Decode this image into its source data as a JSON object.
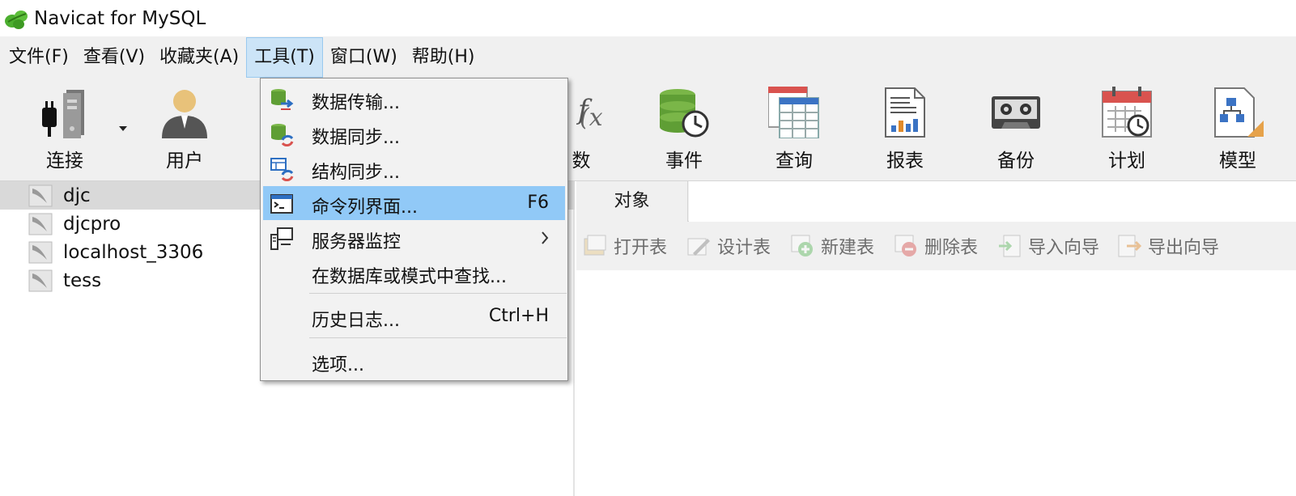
{
  "window": {
    "title": "Navicat for MySQL"
  },
  "menubar": {
    "items": [
      {
        "label": "文件(F)"
      },
      {
        "label": "查看(V)"
      },
      {
        "label": "收藏夹(A)"
      },
      {
        "label": "工具(T)"
      },
      {
        "label": "窗口(W)"
      },
      {
        "label": "帮助(H)"
      }
    ],
    "active_index": 3
  },
  "toolbar": {
    "buttons": [
      {
        "label": "连接",
        "icon": "connection-plug-icon"
      },
      {
        "label": "用户",
        "icon": "user-icon"
      },
      {
        "label": "数",
        "icon": "function-icon"
      },
      {
        "label": "事件",
        "icon": "event-database-clock-icon"
      },
      {
        "label": "查询",
        "icon": "query-table-icon"
      },
      {
        "label": "报表",
        "icon": "report-icon"
      },
      {
        "label": "备份",
        "icon": "backup-tape-icon"
      },
      {
        "label": "计划",
        "icon": "schedule-calendar-icon"
      },
      {
        "label": "模型",
        "icon": "model-diagram-icon"
      }
    ]
  },
  "connections": [
    {
      "label": "djc",
      "selected": true
    },
    {
      "label": "djcpro",
      "selected": false
    },
    {
      "label": "localhost_3306",
      "selected": false
    },
    {
      "label": "tess",
      "selected": false
    }
  ],
  "object_tab": {
    "label": "对象"
  },
  "object_toolbar": {
    "buttons": [
      {
        "label": "打开表",
        "icon": "open-table-icon"
      },
      {
        "label": "设计表",
        "icon": "design-table-icon"
      },
      {
        "label": "新建表",
        "icon": "new-table-icon"
      },
      {
        "label": "删除表",
        "icon": "delete-table-icon"
      },
      {
        "label": "导入向导",
        "icon": "import-wizard-icon"
      },
      {
        "label": "导出向导",
        "icon": "export-wizard-icon"
      }
    ]
  },
  "tools_menu": {
    "items": [
      {
        "label": "数据传输...",
        "shortcut": "",
        "icon": "data-transfer-icon"
      },
      {
        "label": "数据同步...",
        "shortcut": "",
        "icon": "data-sync-icon"
      },
      {
        "label": "结构同步...",
        "shortcut": "",
        "icon": "structure-sync-icon"
      },
      {
        "label": "命令列界面...",
        "shortcut": "F6",
        "icon": "console-icon",
        "highlighted": true
      },
      {
        "label": "服务器监控",
        "shortcut": "",
        "icon": "server-monitor-icon",
        "submenu": true
      },
      {
        "label": "在数据库或模式中查找...",
        "shortcut": ""
      },
      {
        "label": "历史日志...",
        "shortcut": "Ctrl+H"
      },
      {
        "label": "选项...",
        "shortcut": ""
      }
    ]
  },
  "colors": {
    "menu_highlight": "#91c9f7",
    "menubar_active": "#cce4f7",
    "selection_gray": "#d9d9d9",
    "chrome_bg": "#f0f0f0"
  }
}
